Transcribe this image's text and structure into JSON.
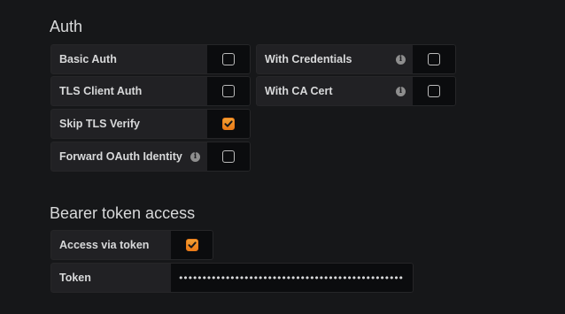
{
  "auth": {
    "title": "Auth",
    "basic_auth": {
      "label": "Basic Auth",
      "checked": false
    },
    "with_credentials": {
      "label": "With Credentials",
      "checked": false,
      "info_icon": "info-icon"
    },
    "tls_client_auth": {
      "label": "TLS Client Auth",
      "checked": false
    },
    "with_ca_cert": {
      "label": "With CA Cert",
      "checked": false,
      "info_icon": "info-icon"
    },
    "skip_tls_verify": {
      "label": "Skip TLS Verify",
      "checked": true
    },
    "forward_oauth": {
      "label": "Forward OAuth Identity",
      "checked": false,
      "info_icon": "info-icon"
    }
  },
  "bearer": {
    "title": "Bearer token access",
    "access_via_token": {
      "label": "Access via token",
      "checked": true
    },
    "token": {
      "label": "Token",
      "value": "••••••••••••••••••••••••••••••••••••••••••••••••••••••••••••..."
    }
  },
  "colors": {
    "background": "#161719",
    "label_bg": "#212124",
    "input_bg": "#0b0c0e",
    "accent": "#eb7b18"
  }
}
